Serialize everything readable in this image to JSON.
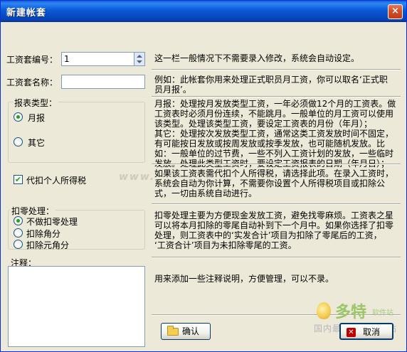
{
  "window": {
    "title": "新建帐套",
    "close_glyph": "×"
  },
  "fields": {
    "number_label": "工资套编号：",
    "number_value": "1",
    "name_label": "工资套名称：",
    "name_value": ""
  },
  "report_type": {
    "title": "报表类型：",
    "options": [
      {
        "label": "月报",
        "checked": true
      },
      {
        "label": "其它",
        "checked": false
      }
    ]
  },
  "tax": {
    "label": "代扣个人所得税",
    "checked": true,
    "check_glyph": "✔"
  },
  "rounding": {
    "title": "扣零处理：",
    "options": [
      {
        "label": "不做扣零处理",
        "checked": true
      },
      {
        "label": "扣除角分",
        "checked": false
      },
      {
        "label": "扣除元角分",
        "checked": false
      }
    ]
  },
  "notes": {
    "label": "注释：",
    "value": ""
  },
  "descriptions": {
    "number": "这一栏一般情况下不需要录入修改，系统会自动设定。",
    "name": [
      "例如：此帐套你用来处理正式职员月工资，你可以取名‘正式职",
      "员月报’。"
    ],
    "report_type": [
      "月报：处理按月发放类型工资，一年必须做12个月的工资表。做",
      "工资表时必须月份连续，不能跳月。一般单位的月工资可以使用",
      "该类型。处理该类型工资，要设定工资表的月份（年月）；",
      "其它：处理按次发放类型工资，通常这类工资发放时间不固定，",
      "有可能按日发放或按周发放或按季发放，也可能随机发放。比",
      "如：一般单位的过节费，一些不列入工资计划的发放，一些临时",
      "发放。处理此类型工资时，要设定工资报表的日期（年月日）；"
    ],
    "tax": [
      "如果该工资表需代扣个人所得税，请选择此项。在录入工资时，",
      "系统会自动为你计算，不需要你设置个人所得税项目或扣除公",
      "式，一切由系统自动进行。"
    ],
    "rounding": [
      "扣零处理主要为方便现金发放工资，避免找零麻烦。工资表之星",
      "可以将本月扣除的零尾自动补到下一个月中。如果你选择了扣零",
      "处理，则工资表中的‘实发合计’项目为扣除了零尾后的工资，",
      "‘工资合计’项目为未扣除零尾的工资。"
    ],
    "notes": "用来添加一些注释说明，方便管理，可以不录。"
  },
  "buttons": {
    "ok_label": "确认",
    "cancel_label": "取消"
  },
  "branding": {
    "watermark": "www.",
    "logo_main": "多特",
    "logo_small": "软件站",
    "logo_sub": "国内最安全的软件站"
  }
}
